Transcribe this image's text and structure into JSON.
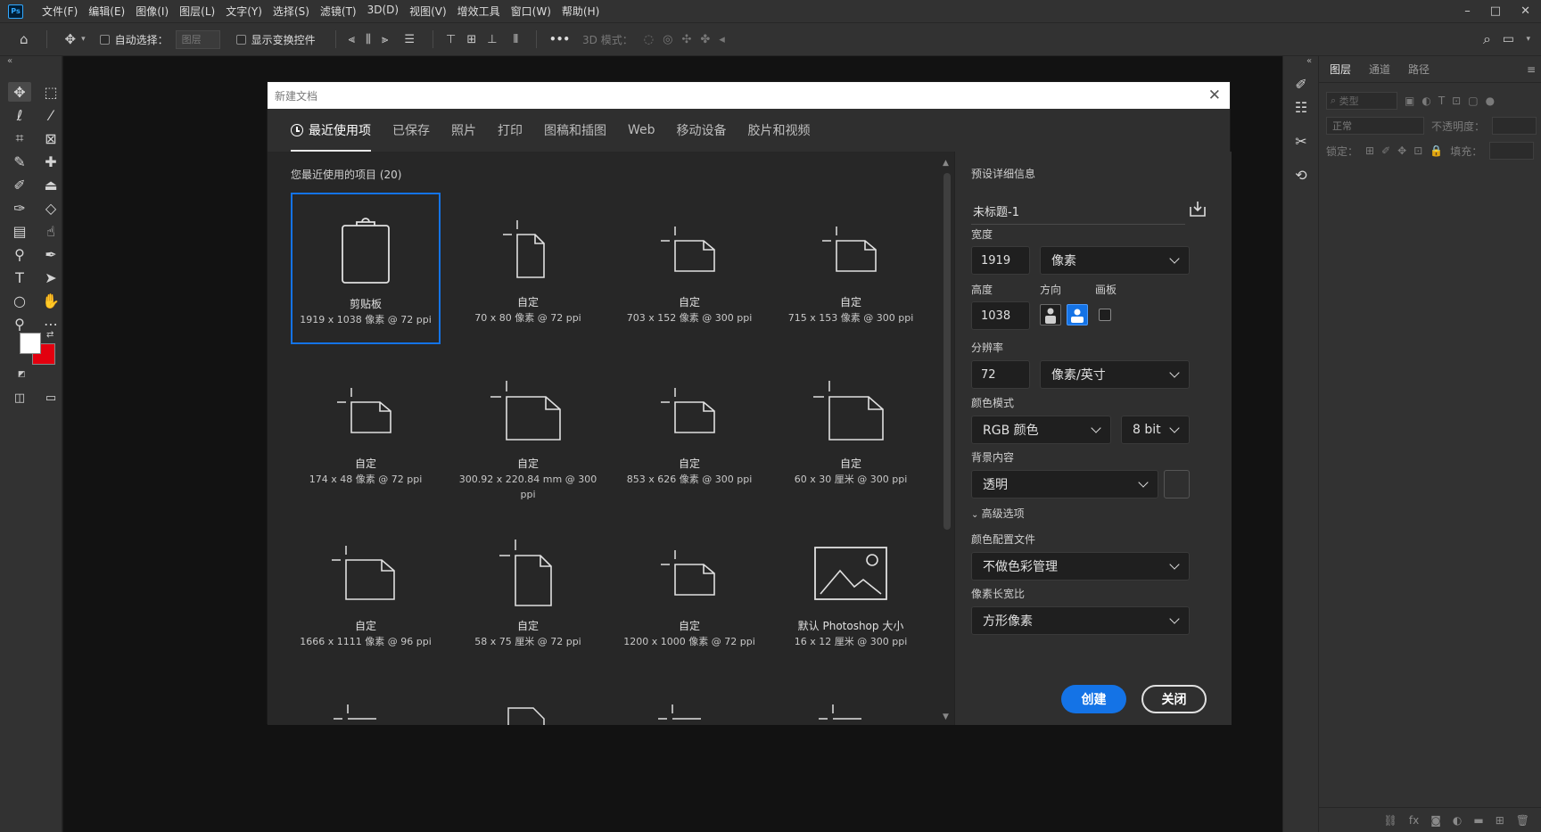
{
  "menu": {
    "items": [
      "文件(F)",
      "编辑(E)",
      "图像(I)",
      "图层(L)",
      "文字(Y)",
      "选择(S)",
      "滤镜(T)",
      "3D(D)",
      "视图(V)",
      "增效工具",
      "窗口(W)",
      "帮助(H)"
    ]
  },
  "window_controls": {
    "minimize": "–",
    "maximize": "□",
    "close": "✕"
  },
  "options": {
    "auto_select_label": "自动选择：",
    "auto_select_target": "图层",
    "show_transform_label": "显示变换控件",
    "mode_3d_label": "3D 模式：",
    "more": "•••"
  },
  "layers_panel": {
    "tabs": [
      "图层",
      "通道",
      "路径"
    ],
    "filter_placeholder": "类型",
    "blend_mode": "正常",
    "opacity_label": "不透明度：",
    "lock_label": "锁定：",
    "fill_label": "填充："
  },
  "dialog": {
    "title": "新建文档",
    "close_glyph": "✕",
    "tabs": [
      "最近使用项",
      "已保存",
      "照片",
      "打印",
      "图稿和插图",
      "Web",
      "移动设备",
      "胶片和视频"
    ],
    "recent_label": "您最近使用的项目 (20)",
    "presets": [
      {
        "name": "剪贴板",
        "dim": "1919 x 1038 像素 @ 72 ppi",
        "icon": "clipboard-icon"
      },
      {
        "name": "自定",
        "dim": "70 x 80 像素 @ 72 ppi",
        "icon": "portrait-doc-icon"
      },
      {
        "name": "自定",
        "dim": "703 x 152 像素 @ 300 ppi",
        "icon": "landscape-doc-icon"
      },
      {
        "name": "自定",
        "dim": "715 x 153 像素 @ 300 ppi",
        "icon": "landscape-doc-icon"
      },
      {
        "name": "自定",
        "dim": "174 x 48 像素 @ 72 ppi",
        "icon": "landscape-doc-icon"
      },
      {
        "name": "自定",
        "dim": "300.92 x 220.84 mm @ 300 ppi",
        "icon": "landscape-doc-icon"
      },
      {
        "name": "自定",
        "dim": "853 x 626 像素 @ 300 ppi",
        "icon": "landscape-doc-icon"
      },
      {
        "name": "自定",
        "dim": "60 x 30 厘米 @ 300 ppi",
        "icon": "landscape-doc-icon"
      },
      {
        "name": "自定",
        "dim": "1666 x 1111 像素 @ 96 ppi",
        "icon": "landscape-doc-icon"
      },
      {
        "name": "自定",
        "dim": "58 x 75 厘米 @ 72 ppi",
        "icon": "portrait-doc-icon"
      },
      {
        "name": "自定",
        "dim": "1200 x 1000 像素 @ 72 ppi",
        "icon": "landscape-doc-icon"
      },
      {
        "name": "默认 Photoshop 大小",
        "dim": "16 x 12 厘米 @ 300 ppi",
        "icon": "image-icon"
      }
    ],
    "details": {
      "header": "预设详细信息",
      "doc_name": "未标题-1",
      "width_label": "宽度",
      "width_value": "1919",
      "width_unit": "像素",
      "height_label": "高度",
      "height_value": "1038",
      "orientation_label": "方向",
      "artboard_label": "画板",
      "resolution_label": "分辨率",
      "resolution_value": "72",
      "resolution_unit": "像素/英寸",
      "color_mode_label": "颜色模式",
      "color_mode_value": "RGB 颜色",
      "bit_depth": "8 bit",
      "background_label": "背景内容",
      "background_value": "透明",
      "advanced_label": "高级选项",
      "color_profile_label": "颜色配置文件",
      "color_profile_value": "不做色彩管理",
      "pixel_aspect_label": "像素长宽比",
      "pixel_aspect_value": "方形像素",
      "create_button": "创建",
      "close_button": "关闭"
    }
  },
  "colors": {
    "accent": "#1473e6",
    "foreground_swatch": "#ffffff",
    "background_swatch": "#e3000f"
  }
}
